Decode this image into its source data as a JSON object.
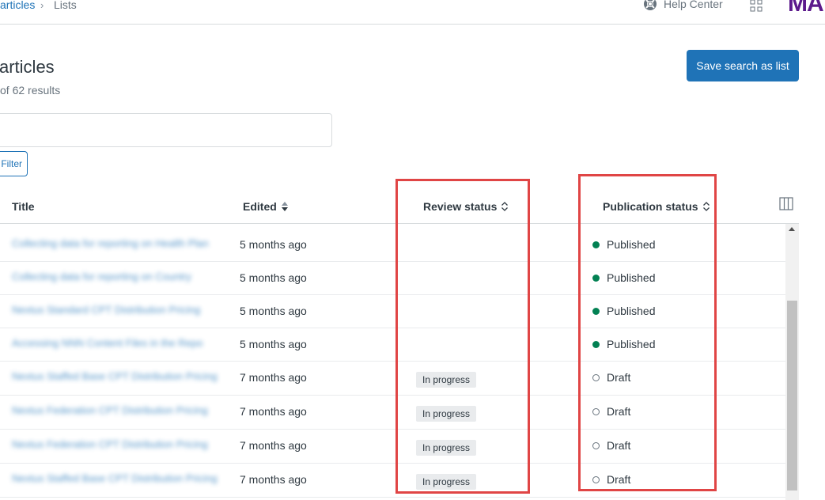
{
  "breadcrumb": {
    "parent": "articles",
    "current": "Lists"
  },
  "header": {
    "help_label": "Help Center",
    "logo_text": "MA"
  },
  "page": {
    "title": "articles",
    "results": "of 62 results"
  },
  "actions": {
    "save_label": "Save search as list",
    "filter_label": "Filter"
  },
  "search": {
    "value": "",
    "placeholder": ""
  },
  "table": {
    "columns": {
      "title": "Title",
      "edited": "Edited",
      "review": "Review status",
      "publication": "Publication status"
    },
    "rows": [
      {
        "title": "Collecting data for reporting on Health Plan",
        "edited": "5 months ago",
        "review": "",
        "publication": "Published"
      },
      {
        "title": "Collecting data for reporting on Country",
        "edited": "5 months ago",
        "review": "",
        "publication": "Published"
      },
      {
        "title": "Nextus Standard CPT Distribution Pricing",
        "edited": "5 months ago",
        "review": "",
        "publication": "Published"
      },
      {
        "title": "Accessing NNN Content Files in the Repo",
        "edited": "5 months ago",
        "review": "",
        "publication": "Published"
      },
      {
        "title": "Nextus Staffed Base CPT Distribution Pricing",
        "edited": "7 months ago",
        "review": "In progress",
        "publication": "Draft"
      },
      {
        "title": "Nextus Federation CPT Distribution Pricing",
        "edited": "7 months ago",
        "review": "In progress",
        "publication": "Draft"
      },
      {
        "title": "Nextus Federation CPT Distribution Pricing",
        "edited": "7 months ago",
        "review": "In progress",
        "publication": "Draft"
      },
      {
        "title": "Nextus Staffed Base CPT Distribution Pricing",
        "edited": "7 months ago",
        "review": "In progress",
        "publication": "Draft"
      }
    ]
  },
  "colors": {
    "accent": "#1f73b7",
    "published": "#038153",
    "highlight": "#e04545",
    "logo": "#5c1a8c"
  },
  "icons": [
    "lifebuoy-icon",
    "apps-grid-icon",
    "sort-icon",
    "columns-icon",
    "chevron-right-icon"
  ]
}
